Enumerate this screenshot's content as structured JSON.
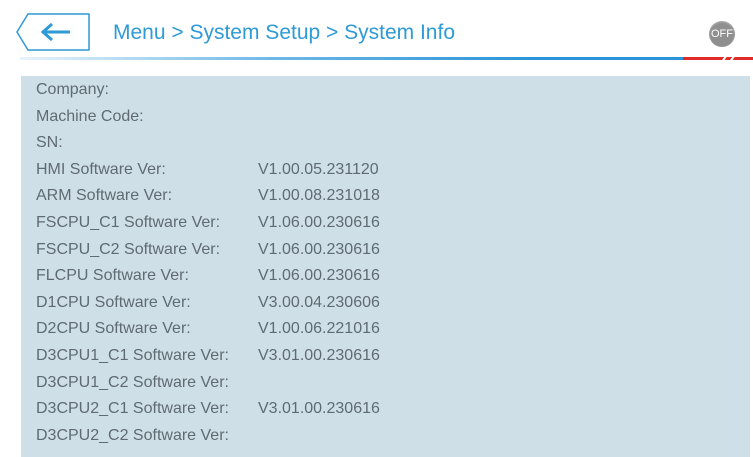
{
  "header": {
    "breadcrumb": "Menu > System Setup > System Info",
    "off_label": "OFF"
  },
  "info": {
    "rows": [
      {
        "label": "Company:",
        "value": ""
      },
      {
        "label": "Machine Code:",
        "value": ""
      },
      {
        "label": "SN:",
        "value": ""
      },
      {
        "label": "HMI Software Ver:",
        "value": "V1.00.05.231120"
      },
      {
        "label": "ARM Software Ver:",
        "value": "V1.00.08.231018"
      },
      {
        "label": "FSCPU_C1 Software Ver:",
        "value": "V1.06.00.230616"
      },
      {
        "label": "FSCPU_C2 Software Ver:",
        "value": "V1.06.00.230616"
      },
      {
        "label": "FLCPU Software Ver:",
        "value": "V1.06.00.230616"
      },
      {
        "label": "D1CPU Software Ver:",
        "value": "V3.00.04.230606"
      },
      {
        "label": "D2CPU Software Ver:",
        "value": "V1.00.06.221016"
      },
      {
        "label": "D3CPU1_C1 Software Ver:",
        "value": "V3.01.00.230616"
      },
      {
        "label": "D3CPU1_C2 Software Ver:",
        "value": ""
      },
      {
        "label": "D3CPU2_C1 Software Ver:",
        "value": "V3.01.00.230616"
      },
      {
        "label": "D3CPU2_C2 Software Ver:",
        "value": ""
      }
    ]
  },
  "colors": {
    "accent": "#2e9ad6",
    "panel_bg": "#cfdfe7",
    "text": "#5f6b72",
    "off_button": "#8f8f8f",
    "alert_mark": "#e12b2b"
  },
  "icons": {
    "back": "arrow-left-icon"
  }
}
